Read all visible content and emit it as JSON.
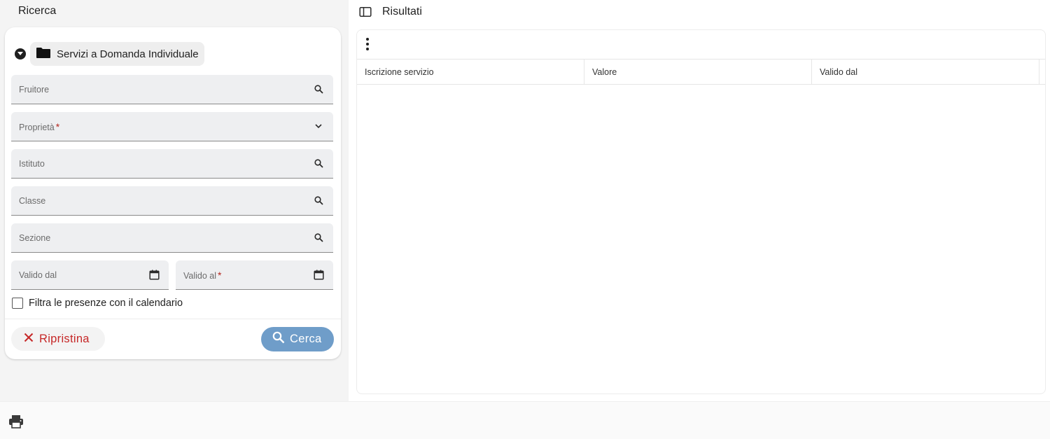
{
  "search_panel": {
    "title": "Ricerca",
    "group_label": "Servizi a Domanda Individuale",
    "fields": {
      "fruitore": "Fruitore",
      "proprieta": "Proprietà",
      "istituto": "Istituto",
      "classe": "Classe",
      "sezione": "Sezione",
      "valido_dal": "Valido dal",
      "valido_al": "Valido al"
    },
    "required_mark": "*",
    "checkbox_label": "Filtra le presenze con il calendario",
    "reset_label": "Ripristina",
    "search_label": "Cerca"
  },
  "results_panel": {
    "title": "Risultati",
    "columns": [
      "Iscrizione servizio",
      "Valore",
      "Valido dal"
    ],
    "rows": []
  },
  "colors": {
    "accent_button": "#6f9dc9",
    "reset_red": "#c62828",
    "required_red": "#b3261e"
  },
  "icons": [
    "caret-down-icon",
    "folder-icon",
    "search-icon",
    "chevron-down-icon",
    "calendar-icon",
    "close-icon",
    "sidebar-toggle-icon",
    "more-vert-icon",
    "print-icon"
  ]
}
